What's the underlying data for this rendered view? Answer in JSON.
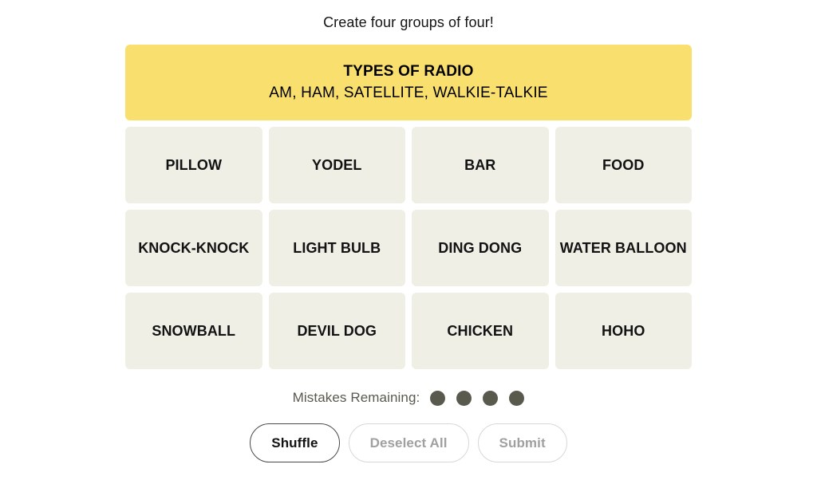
{
  "page": {
    "title": "Create four groups of four!",
    "background_color": "#ffffff"
  },
  "colors": {
    "solved_yellow": "#f9df6d",
    "tile_background": "#efefe6",
    "tile_text": "#121212",
    "dot_color": "#5a594e",
    "disabled_text": "#a0a0a0",
    "disabled_border": "#d8d8d8",
    "active_border": "#4a4a4a"
  },
  "board": {
    "solved_groups": [
      {
        "category": "TYPES OF RADIO",
        "members_text": "AM, HAM, SATELLITE, WALKIE-TALKIE",
        "members": [
          "AM",
          "HAM",
          "SATELLITE",
          "WALKIE-TALKIE"
        ],
        "color": "#f9df6d",
        "difficulty": "yellow"
      }
    ],
    "rows": [
      {
        "tiles": [
          {
            "label": "PILLOW"
          },
          {
            "label": "YODEL"
          },
          {
            "label": "BAR"
          },
          {
            "label": "FOOD"
          }
        ]
      },
      {
        "tiles": [
          {
            "label": "KNOCK-KNOCK"
          },
          {
            "label": "LIGHT BULB"
          },
          {
            "label": "DING DONG"
          },
          {
            "label": "WATER BALLOON"
          }
        ]
      },
      {
        "tiles": [
          {
            "label": "SNOWBALL"
          },
          {
            "label": "DEVIL DOG"
          },
          {
            "label": "CHICKEN"
          },
          {
            "label": "HOHO"
          }
        ]
      }
    ]
  },
  "mistakes": {
    "label": "Mistakes Remaining:",
    "remaining": 4,
    "dots": [
      "filled",
      "filled",
      "filled",
      "filled"
    ]
  },
  "actions": {
    "shuffle": {
      "label": "Shuffle",
      "enabled": true
    },
    "deselect_all": {
      "label": "Deselect All",
      "enabled": false
    },
    "submit": {
      "label": "Submit",
      "enabled": false
    }
  }
}
